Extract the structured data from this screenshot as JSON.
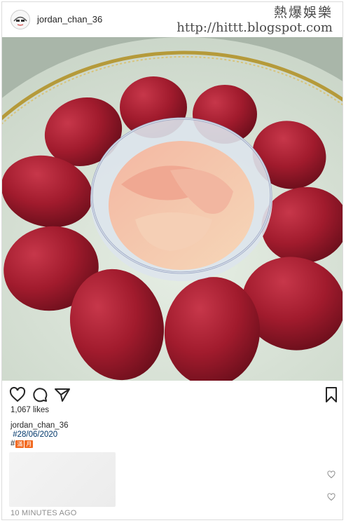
{
  "header": {
    "username": "jordan_chan_36"
  },
  "watermark": {
    "line1": "熱爆娛樂",
    "line2": "http://hittt.blogspot.com"
  },
  "photo": {
    "subject": "Plate of red eggs with pickled ginger"
  },
  "actions": {
    "icons": [
      "heart-icon",
      "comment-icon",
      "share-icon",
      "bookmark-icon"
    ]
  },
  "likes": {
    "text": "1,067 likes"
  },
  "caption": {
    "username": "jordan_chan_36",
    "date_line": "#28/06/2020",
    "hash": "#",
    "emoji1": "滿",
    "emoji2": "月"
  },
  "timestamp": {
    "text": "10 MINUTES AGO"
  },
  "colors": {
    "egg": "#a11b2d",
    "plate": "#d7e2d6",
    "gold_rim": "#b59a3a",
    "link": "#00376b"
  }
}
